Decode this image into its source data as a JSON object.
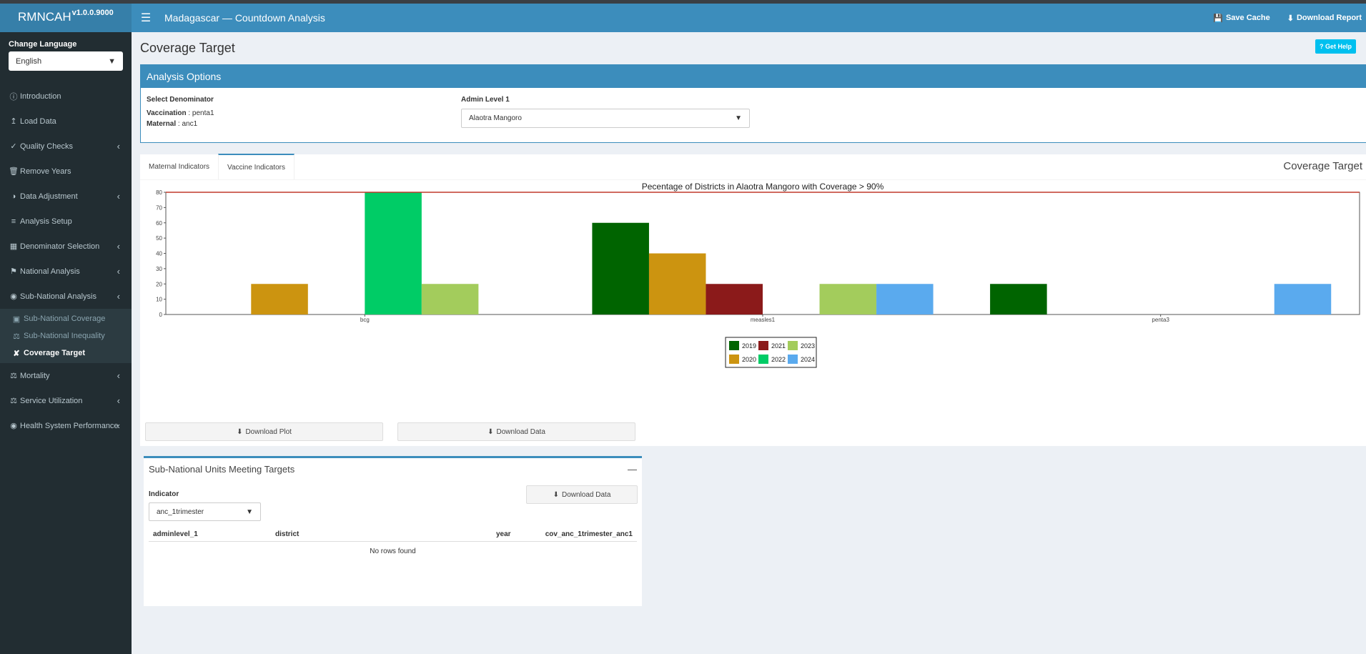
{
  "app": {
    "name": "RMNCAH",
    "version": "v1.0.0.9000",
    "title": "Madagascar — Countdown Analysis"
  },
  "navbar": {
    "save_cache": "Save Cache",
    "download_report": "Download Report"
  },
  "sidebar": {
    "language_label": "Change Language",
    "language_value": "English",
    "items": [
      {
        "label": "Introduction",
        "icon": "info-icon"
      },
      {
        "label": "Load Data",
        "icon": "upload-icon"
      },
      {
        "label": "Quality Checks",
        "icon": "check-circle-icon"
      },
      {
        "label": "Remove Years",
        "icon": "trash-icon"
      },
      {
        "label": "Data Adjustment",
        "icon": "adjust-icon"
      },
      {
        "label": "Analysis Setup",
        "icon": "sliders-icon"
      },
      {
        "label": "Denominator Selection",
        "icon": "calculator-icon"
      },
      {
        "label": "National Analysis",
        "icon": "flag-icon"
      },
      {
        "label": "Sub-National Analysis",
        "icon": "globe-icon"
      }
    ],
    "subitems": [
      {
        "label": "Sub-National Coverage"
      },
      {
        "label": "Sub-National Inequality"
      },
      {
        "label": "Coverage Target"
      }
    ],
    "items_after": [
      {
        "label": "Mortality"
      },
      {
        "label": "Service Utilization"
      },
      {
        "label": "Health System Performance"
      }
    ]
  },
  "page": {
    "title": "Coverage Target",
    "help": "Get Help"
  },
  "options": {
    "header": "Analysis Options",
    "denominator_label": "Select Denominator",
    "vaccination_label": "Vaccination",
    "vaccination_value": "penta1",
    "maternal_label": "Maternal",
    "maternal_value": "anc1",
    "admin_label": "Admin Level 1",
    "admin_value": "Alaotra Mangoro"
  },
  "tabs": {
    "maternal": "Maternal Indicators",
    "vaccine": "Vaccine Indicators",
    "right_title": "Coverage Target"
  },
  "buttons": {
    "download_plot": "Download Plot",
    "download_data": "Download Data"
  },
  "chart_data": {
    "type": "bar",
    "title": "Pecentage of Districts in Alaotra Mangoro with Coverage > 90%",
    "categories": [
      "bcg",
      "measles1",
      "penta3"
    ],
    "ylim": [
      0,
      80
    ],
    "yticks": [
      0,
      10,
      20,
      30,
      40,
      50,
      60,
      70,
      80
    ],
    "reference_line": 80,
    "reference_color": "#c0392b",
    "legend_position": "bottom",
    "series": [
      {
        "name": "2019",
        "color": "#006400",
        "values": [
          0,
          60,
          20
        ]
      },
      {
        "name": "2020",
        "color": "#cc9410",
        "values": [
          20,
          40,
          0
        ]
      },
      {
        "name": "2021",
        "color": "#8b1a1a",
        "values": [
          0,
          20,
          0
        ]
      },
      {
        "name": "2022",
        "color": "#00cc66",
        "values": [
          80,
          0,
          0
        ]
      },
      {
        "name": "2023",
        "color": "#a3cc5c",
        "values": [
          20,
          20,
          0
        ]
      },
      {
        "name": "2024",
        "color": "#5aaaee",
        "values": [
          0,
          20,
          20
        ]
      }
    ]
  },
  "units": {
    "header": "Sub-National Units Meeting Targets",
    "indicator_label": "Indicator",
    "indicator_value": "anc_1trimester",
    "download": "Download Data",
    "columns": [
      "adminlevel_1",
      "district",
      "year",
      "cov_anc_1trimester_anc1"
    ],
    "empty": "No rows found"
  }
}
